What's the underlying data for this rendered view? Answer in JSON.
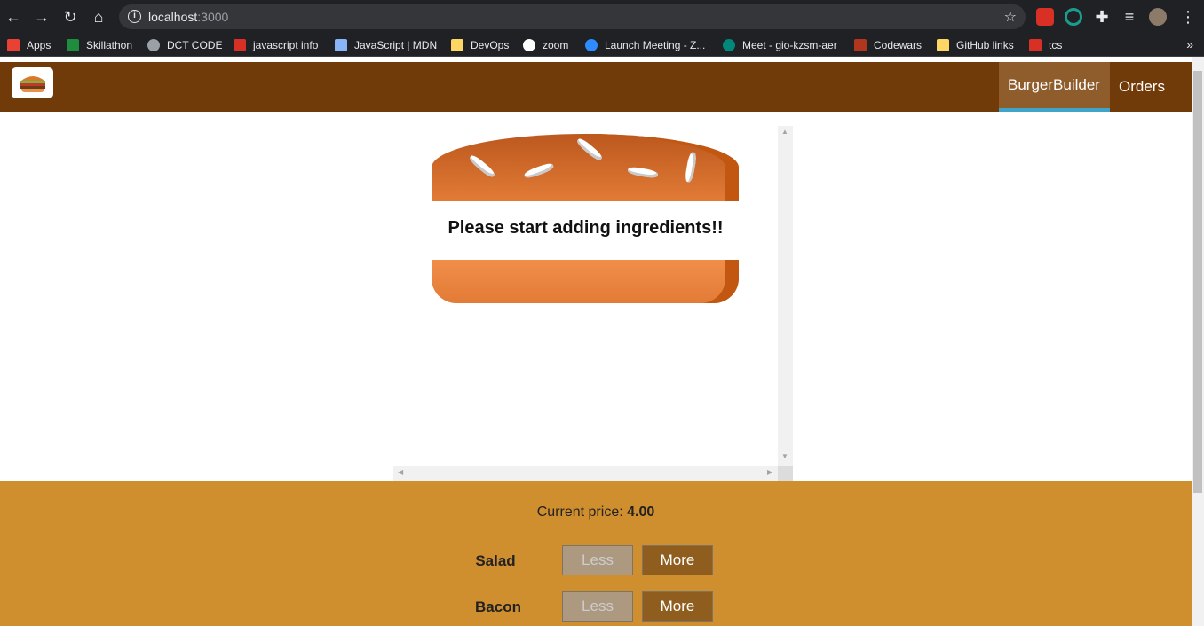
{
  "browser": {
    "url_host": "localhost",
    "url_port": ":3000",
    "bookmarks": [
      {
        "label": "Apps",
        "color": "#e94235"
      },
      {
        "label": "Skillathon",
        "color": "#1e8e3e"
      },
      {
        "label": "DCT CODE",
        "color": "#9aa0a6"
      },
      {
        "label": "javascript info",
        "color": "#d93025"
      },
      {
        "label": "JavaScript | MDN",
        "color": "#8ab4f8"
      },
      {
        "label": "DevOps",
        "color": "#fdd663"
      },
      {
        "label": "zoom",
        "color": "#ffffff"
      },
      {
        "label": "Launch Meeting - Z...",
        "color": "#2d8cff"
      },
      {
        "label": "Meet - gio-kzsm-aer",
        "color": "#00897b"
      },
      {
        "label": "Codewars",
        "color": "#b1361e"
      },
      {
        "label": "GitHub links",
        "color": "#fdd663"
      },
      {
        "label": "tcs",
        "color": "#d93025"
      }
    ]
  },
  "toolbar": {
    "nav": [
      {
        "label": "BurgerBuilder",
        "active": true
      },
      {
        "label": "Orders",
        "active": false
      }
    ]
  },
  "burger": {
    "message": "Please start adding ingredients!!"
  },
  "controls": {
    "price_label": "Current price:",
    "price_value": "4.00",
    "less_label": "Less",
    "more_label": "More",
    "ingredients": [
      {
        "label": "Salad"
      },
      {
        "label": "Bacon"
      }
    ]
  }
}
